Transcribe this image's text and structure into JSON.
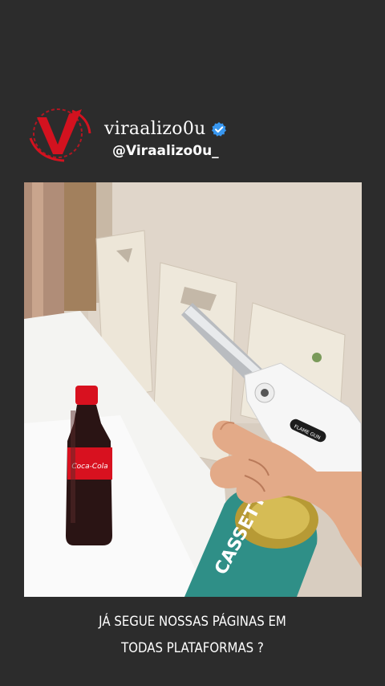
{
  "profile": {
    "display_name": "viraalizo0u",
    "handle": "@Viraalizo0u_",
    "logo_letter": "V",
    "logo_ring_text": "VIRAALIZOU",
    "verified": true
  },
  "media": {
    "kind": "video-frame",
    "bottle_label": "Coca-Cola",
    "torch_label": "FLAME GUN",
    "can_label": "CASSETTE"
  },
  "caption": {
    "line1": "JÁ SEGUE NOSSAS PÁGINAS EM",
    "line2": "TODAS PLATAFORMAS ?"
  },
  "colors": {
    "background": "#2c2c2c",
    "brand_red": "#d3121f",
    "verified_blue": "#3897f0",
    "text": "#ffffff"
  }
}
